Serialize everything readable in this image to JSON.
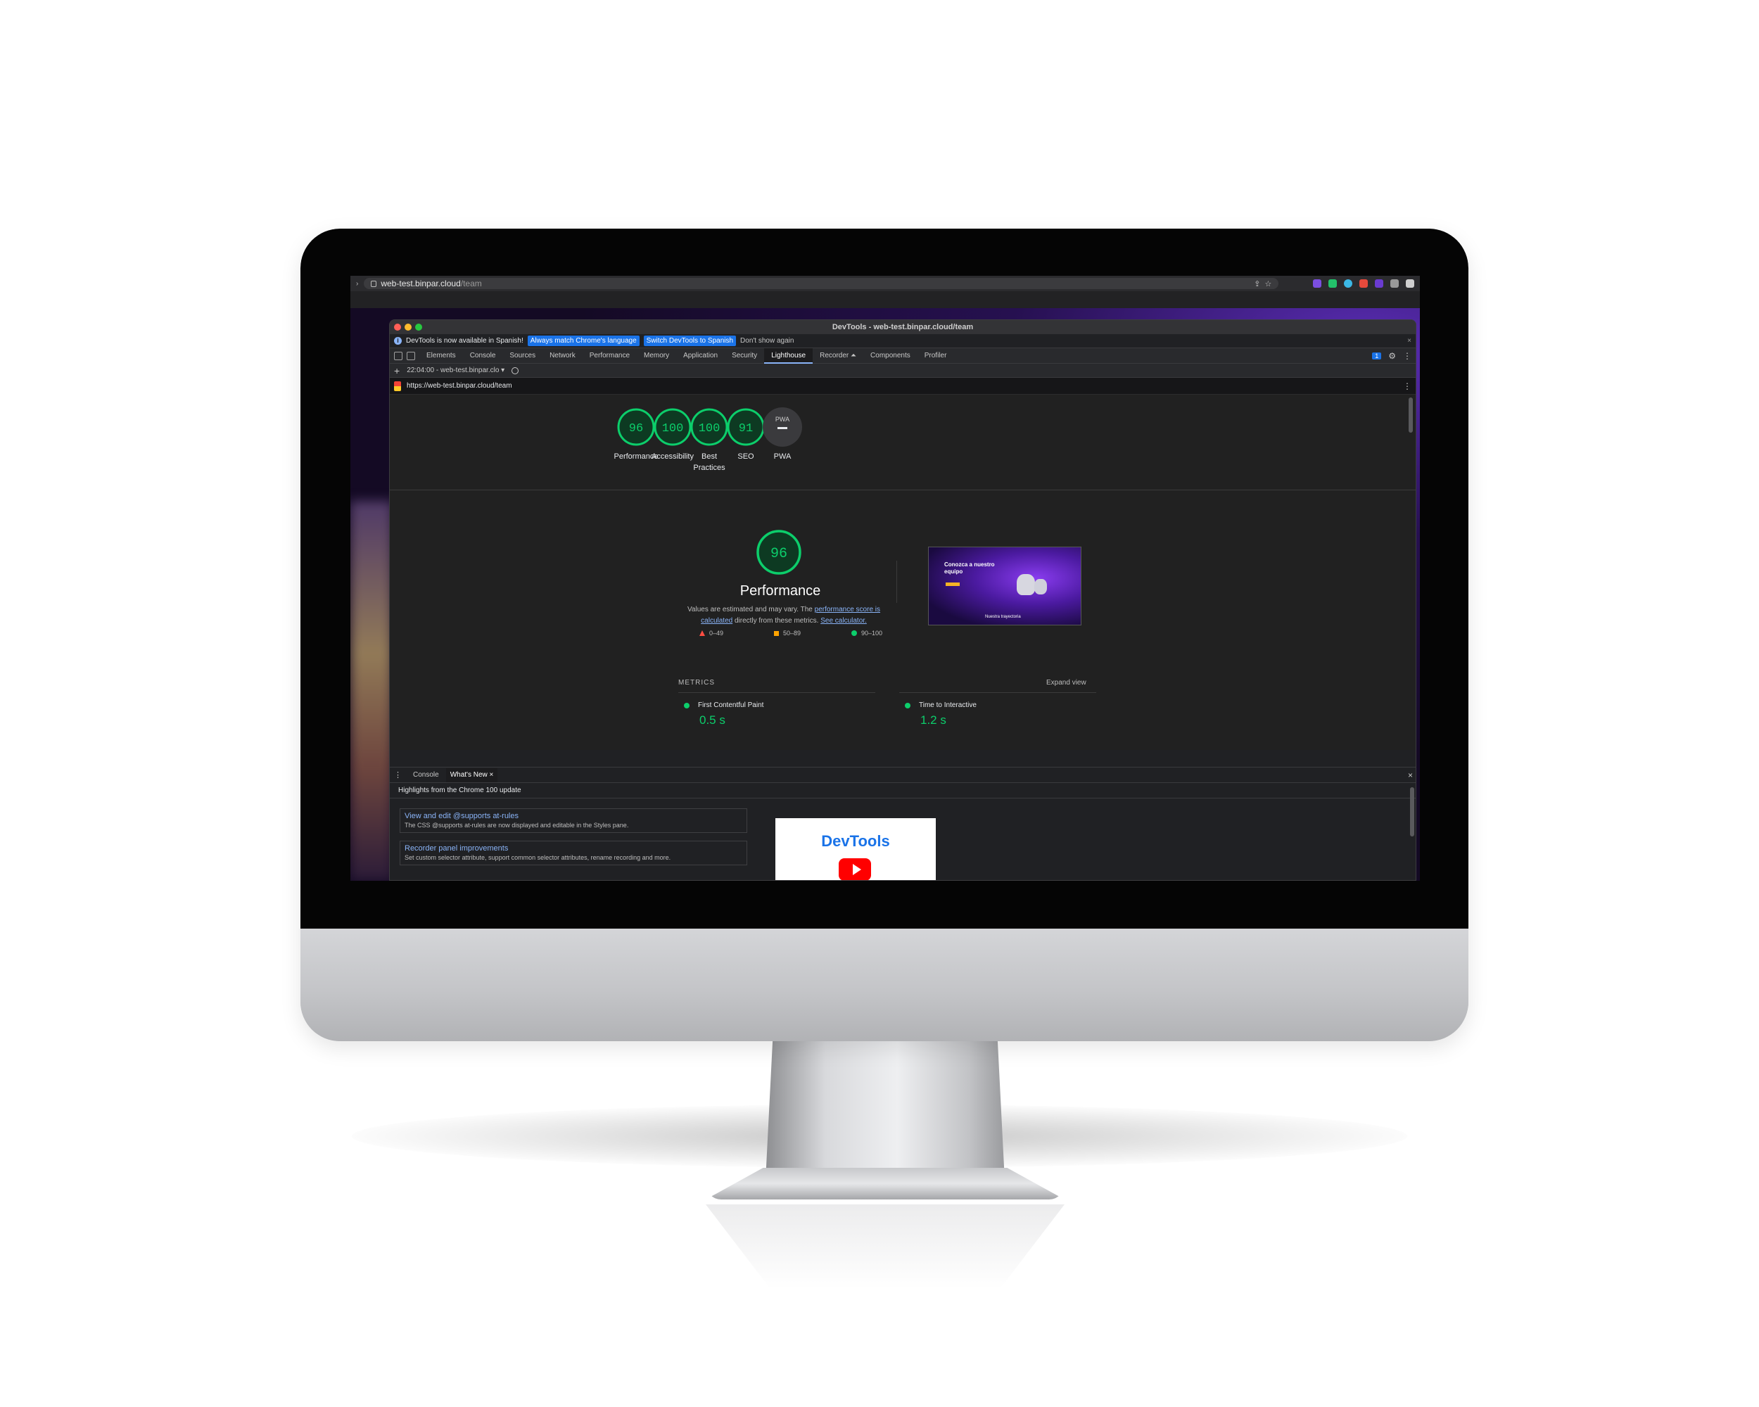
{
  "browser": {
    "address_host": "web-test.binpar.cloud",
    "address_path": "/team"
  },
  "devtools": {
    "window_title": "DevTools - web-test.binpar.cloud/team",
    "infobar": {
      "message": "DevTools is now available in Spanish!",
      "btn_match": "Always match Chrome's language",
      "btn_switch": "Switch DevTools to Spanish",
      "dont_show": "Don't show again"
    },
    "tabs": [
      "Elements",
      "Console",
      "Sources",
      "Network",
      "Performance",
      "Memory",
      "Application",
      "Security",
      "Lighthouse",
      "Recorder ⏶",
      "Components",
      "Profiler"
    ],
    "active_tab": "Lighthouse",
    "issues_badge": "1",
    "report_selector": "22:04:00 - web-test.binpar.clo ▾",
    "report_url": "https://web-test.binpar.cloud/team"
  },
  "lighthouse": {
    "gauges": [
      {
        "score": "96",
        "label": "Performance"
      },
      {
        "score": "100",
        "label": "Accessibility"
      },
      {
        "score": "100",
        "label": "Best Practices"
      },
      {
        "score": "91",
        "label": "SEO"
      },
      {
        "score": "PWA",
        "label": "PWA"
      }
    ],
    "performance": {
      "score": "96",
      "title": "Performance",
      "desc_1": "Values are estimated and may vary. The ",
      "desc_link1": "performance score is calculated",
      "desc_2": " directly from these metrics. ",
      "desc_link2": "See calculator.",
      "legend": [
        "0–49",
        "50–89",
        "90–100"
      ]
    },
    "thumbnail": {
      "heading": "Conozca a nuestro equipo",
      "footer": "Nuestra trayectoria"
    },
    "metrics_header": "METRICS",
    "expand_view": "Expand view",
    "metrics": [
      {
        "name": "First Contentful Paint",
        "value": "0.5 s"
      },
      {
        "name": "Time to Interactive",
        "value": "1.2 s"
      }
    ],
    "colors": {
      "pass": "#0cce6b",
      "average": "#ffa400",
      "fail": "#ff4e42"
    }
  },
  "drawer": {
    "tabs": [
      "Console",
      "What's New"
    ],
    "active_tab": "What's New",
    "highlights": "Highlights from the Chrome 100 update",
    "cards": [
      {
        "title": "View and edit @supports at-rules",
        "desc": "The CSS @supports at-rules are now displayed and editable in the Styles pane."
      },
      {
        "title": "Recorder panel improvements",
        "desc": "Set custom selector attribute, support common selector attributes, rename recording and more."
      }
    ],
    "video_title": "DevTools"
  }
}
